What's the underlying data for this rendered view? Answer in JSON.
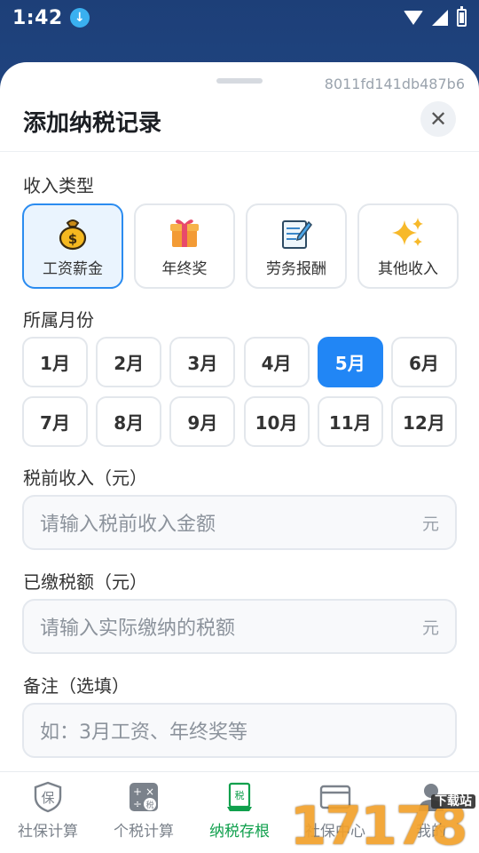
{
  "status": {
    "time": "1:42"
  },
  "sheet": {
    "record_id": "8011fd141db487b6",
    "title": "添加纳税记录"
  },
  "income_type": {
    "label": "收入类型",
    "options": [
      {
        "label": "工资薪金",
        "icon": "money-bag-icon",
        "selected": true
      },
      {
        "label": "年终奖",
        "icon": "gift-icon",
        "selected": false
      },
      {
        "label": "劳务报酬",
        "icon": "memo-icon",
        "selected": false
      },
      {
        "label": "其他收入",
        "icon": "sparkles-icon",
        "selected": false
      }
    ]
  },
  "month": {
    "label": "所属月份",
    "options": [
      "1月",
      "2月",
      "3月",
      "4月",
      "5月",
      "6月",
      "7月",
      "8月",
      "9月",
      "10月",
      "11月",
      "12月"
    ],
    "selected": "5月"
  },
  "pretax": {
    "label": "税前收入（元）",
    "placeholder": "请输入税前收入金额",
    "unit": "元"
  },
  "paid_tax": {
    "label": "已缴税额（元）",
    "placeholder": "请输入实际缴纳的税额",
    "unit": "元"
  },
  "note": {
    "label": "备注（选填）",
    "placeholder": "如：3月工资、年终奖等"
  },
  "tabs": [
    {
      "label": "社保计算",
      "icon": "shield-icon",
      "active": false
    },
    {
      "label": "个税计算",
      "icon": "calculator-icon",
      "active": false
    },
    {
      "label": "纳税存根",
      "icon": "receipt-icon",
      "active": true
    },
    {
      "label": "社保中心",
      "icon": "card-icon",
      "active": false
    },
    {
      "label": "我的",
      "icon": "person-icon",
      "active": false
    }
  ],
  "watermark": {
    "text": "17178",
    "sub": "下载站"
  },
  "colors": {
    "accent": "#2186f5",
    "active_tab": "#10a04d"
  }
}
